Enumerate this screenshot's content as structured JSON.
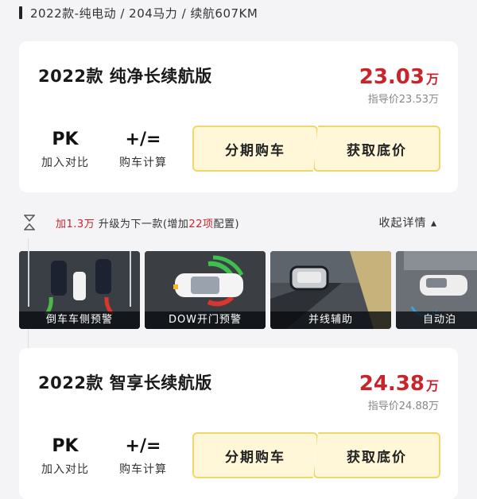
{
  "header": {
    "title": "2022款-纯电动 / 204马力 / 续航607KM"
  },
  "cards": [
    {
      "name": "2022款 纯净长续航版",
      "price": "23.03",
      "price_unit": "万",
      "guide_price": "指导价23.53万",
      "pk_icon": "PK",
      "pk_label": "加入对比",
      "calc_icon": "+/=",
      "calc_label": "购车计算",
      "installment_button": "分期购车",
      "lowest_price_button": "获取底价"
    },
    {
      "name": "2022款 智享长续航版",
      "price": "24.38",
      "price_unit": "万",
      "guide_price": "指导价24.88万",
      "pk_icon": "PK",
      "pk_label": "加入对比",
      "calc_icon": "+/=",
      "calc_label": "购车计算",
      "installment_button": "分期购车",
      "lowest_price_button": "获取底价"
    }
  ],
  "upgrade": {
    "prefix": "加",
    "amount": "1.3万",
    "middle": " 升级为下一款(增加",
    "count": "22项",
    "suffix": "配置)",
    "collapse_label": "收起详情 ▴"
  },
  "features": [
    {
      "label": "倒车车侧预警",
      "icon": "rear-cross-traffic-alert"
    },
    {
      "label": "DOW开门预警",
      "icon": "door-open-warning"
    },
    {
      "label": "并线辅助",
      "icon": "lane-change-assist"
    },
    {
      "label": "自动泊",
      "icon": "auto-parking"
    }
  ],
  "colors": {
    "price_red": "#c9242b",
    "button_fill": "#fff7d8",
    "button_border": "#f0d76a"
  }
}
